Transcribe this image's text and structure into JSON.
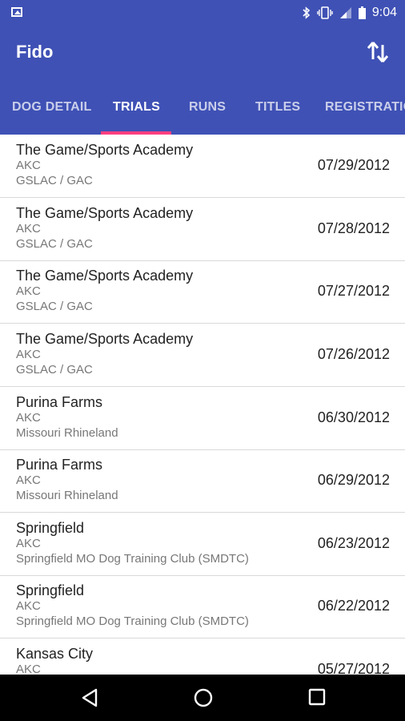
{
  "status_bar": {
    "time": "9:04",
    "icons": [
      "image-icon",
      "bluetooth-icon",
      "vibrate-icon",
      "signal-icon",
      "battery-icon"
    ]
  },
  "app_bar": {
    "title": "Fido",
    "action_icon": "sort-arrows-icon"
  },
  "tabs": [
    {
      "label": "DOG DETAIL",
      "active": false
    },
    {
      "label": "TRIALS",
      "active": true
    },
    {
      "label": "RUNS",
      "active": false
    },
    {
      "label": "TITLES",
      "active": false
    },
    {
      "label": "REGISTRATIO",
      "active": false
    }
  ],
  "trials": [
    {
      "name": "The Game/Sports Academy",
      "org": "AKC",
      "club": "GSLAC / GAC",
      "date": "07/29/2012"
    },
    {
      "name": "The Game/Sports Academy",
      "org": "AKC",
      "club": "GSLAC / GAC",
      "date": "07/28/2012"
    },
    {
      "name": "The Game/Sports Academy",
      "org": "AKC",
      "club": "GSLAC / GAC",
      "date": "07/27/2012"
    },
    {
      "name": "The Game/Sports Academy",
      "org": "AKC",
      "club": "GSLAC / GAC",
      "date": "07/26/2012"
    },
    {
      "name": "Purina Farms",
      "org": "AKC",
      "club": "Missouri Rhineland",
      "date": "06/30/2012"
    },
    {
      "name": "Purina Farms",
      "org": "AKC",
      "club": "Missouri Rhineland",
      "date": "06/29/2012"
    },
    {
      "name": "Springfield",
      "org": "AKC",
      "club": "Springfield MO Dog Training Club (SMDTC)",
      "date": "06/23/2012"
    },
    {
      "name": "Springfield",
      "org": "AKC",
      "club": "Springfield MO Dog Training Club (SMDTC)",
      "date": "06/22/2012"
    },
    {
      "name": "Kansas City",
      "org": "AKC",
      "club": "",
      "date": "05/27/2012"
    }
  ],
  "nav_bar": {
    "icons": [
      "back-icon",
      "home-icon",
      "recents-icon"
    ]
  },
  "colors": {
    "primary": "#3f51b5",
    "accent": "#ff4081"
  }
}
